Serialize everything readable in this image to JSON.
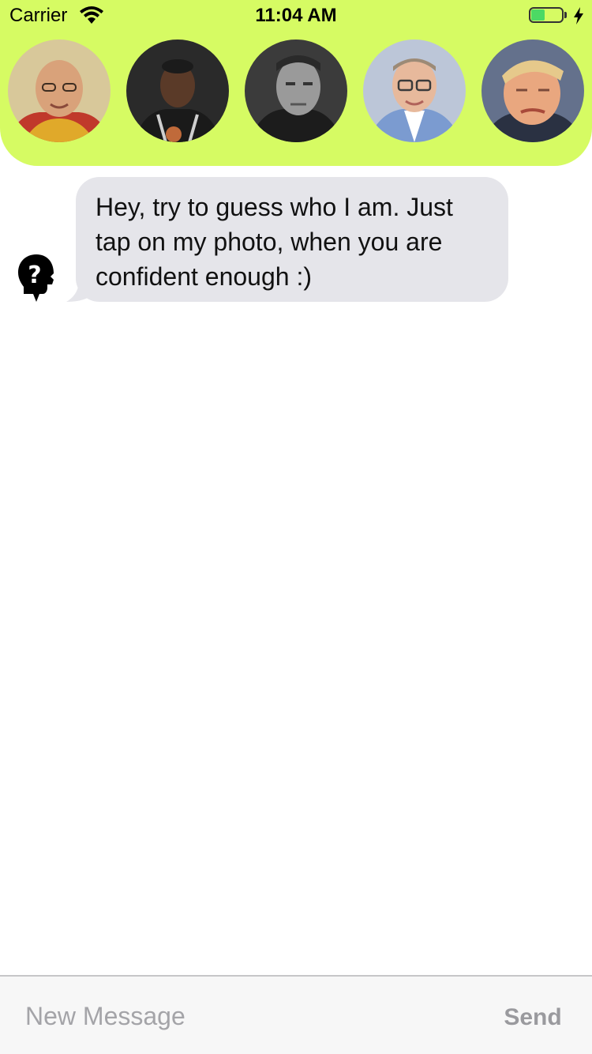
{
  "status_bar": {
    "carrier": "Carrier",
    "time": "11:04 AM",
    "battery_level": 0.45,
    "wifi_icon": "wifi-icon",
    "charging_icon": "bolt-icon"
  },
  "header": {
    "background_color": "#d6fb63",
    "avatars": [
      {
        "name": "avatar-1",
        "bg": "#c9a86a",
        "face": "#d9a27a",
        "robe": "#c0392b",
        "hair": "#7a6a5a"
      },
      {
        "name": "avatar-2",
        "bg": "#2c2c2c",
        "face": "#5a3a28",
        "robe": "#1b1b1b",
        "hair": "#111111"
      },
      {
        "name": "avatar-3",
        "bg": "#3a3a3a",
        "face": "#8a8a8a",
        "robe": "#222222",
        "hair": "#1e1e1e"
      },
      {
        "name": "avatar-4",
        "bg": "#b9c3d6",
        "face": "#e5b89b",
        "robe": "#6d8ec7",
        "hair": "#a08c7a"
      },
      {
        "name": "avatar-5",
        "bg": "#5d6b86",
        "face": "#e8a67e",
        "robe": "#2c3344",
        "hair": "#e4c88a"
      }
    ]
  },
  "chat": {
    "bot_icon": "unknown-person-icon",
    "messages": [
      {
        "text": "Hey, try to guess who I am. Just tap on my photo, when you are confident enough :)"
      }
    ]
  },
  "input_bar": {
    "placeholder": "New Message",
    "value": "",
    "send_label": "Send"
  },
  "colors": {
    "bubble": "#e5e5ea",
    "send_disabled": "#9a9a9e",
    "battery_fill": "#4cd964"
  }
}
